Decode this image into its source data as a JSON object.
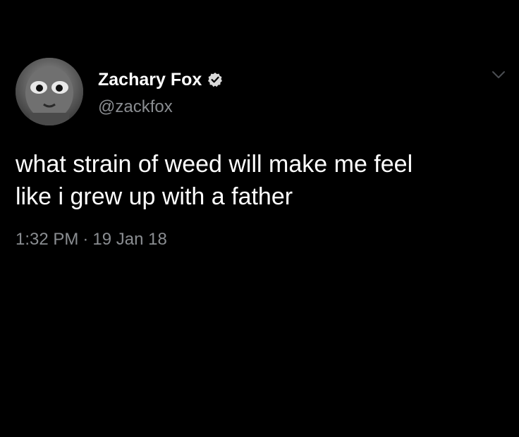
{
  "tweet": {
    "author": {
      "display_name": "Zachary Fox",
      "handle": "@zackfox",
      "verified": true,
      "avatar_icon": "alien-avatar"
    },
    "text": "what strain of weed will make me feel\nlike i grew up with a father",
    "time": "1:32 PM",
    "separator": "·",
    "date": "19 Jan 18",
    "menu_icon": "chevron-down-icon"
  },
  "colors": {
    "background": "#000000",
    "text": "#ffffff",
    "secondary_text": "#8a8d91",
    "verified_badge": "#d9d9d9"
  }
}
